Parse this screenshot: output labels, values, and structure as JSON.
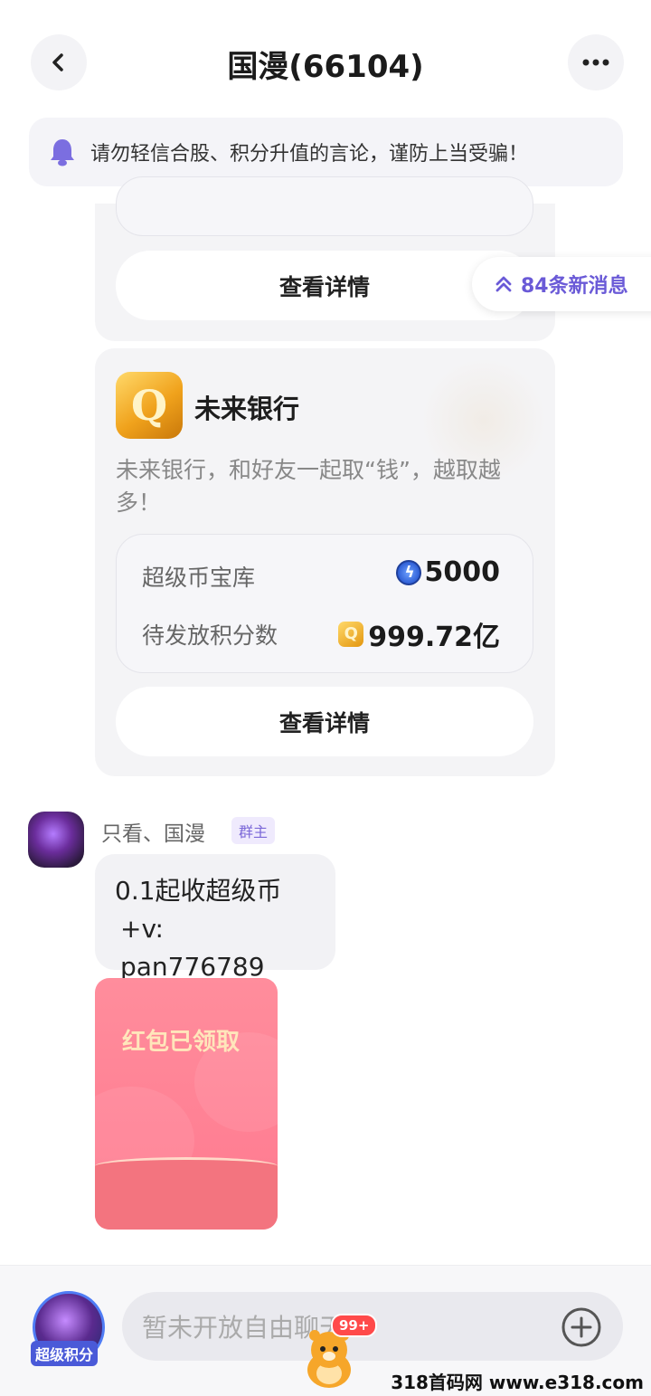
{
  "header": {
    "title": "国漫(66104)"
  },
  "notice": {
    "text": "请勿轻信合股、积分升值的言论，谨防上当受骗！"
  },
  "top_card": {
    "button_label": "查看详情"
  },
  "new_messages": {
    "label": "84条新消息"
  },
  "bank_card": {
    "name": "未来银行",
    "description": "未来银行，和好友一起取“钱”，越取越多！",
    "rows": [
      {
        "label": "超级币宝库",
        "value": "5000"
      },
      {
        "label": "待发放积分数",
        "value": "999.72亿"
      }
    ],
    "button_label": "查看详情"
  },
  "message": {
    "sender": "只看、国漫",
    "role_tag": "群主",
    "text_line1": "0.1起收超级币",
    "text_line2": "+v: pan776789"
  },
  "red_packet": {
    "status": "红包已领取"
  },
  "bottom_bar": {
    "points_label": "超级积分",
    "input_placeholder": "暂未开放自由聊天",
    "badge": "99+"
  },
  "watermark": {
    "text": "318首码网 www.e318.com"
  },
  "colors": {
    "accent": "#6a5ad7",
    "card_bg": "#f4f4f6",
    "red_packet": "#ff8d9c"
  }
}
